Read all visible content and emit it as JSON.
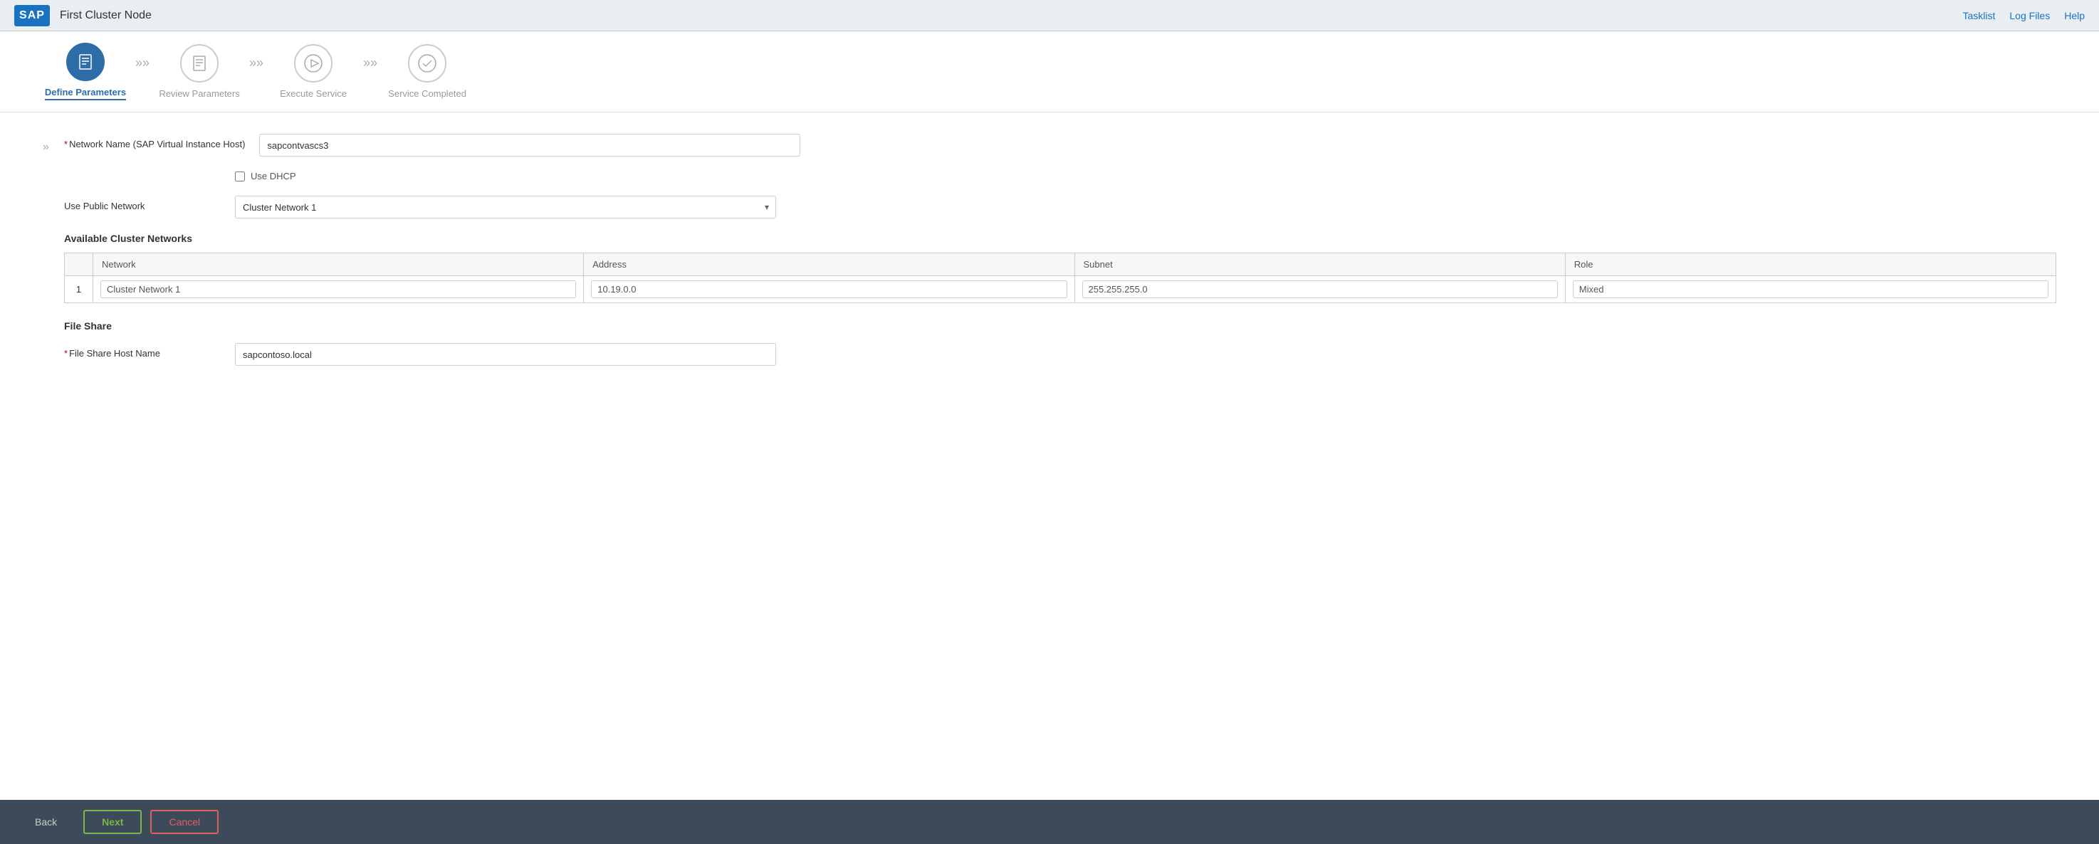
{
  "header": {
    "logo": "SAP",
    "title": "First Cluster Node",
    "nav": [
      "Tasklist",
      "Log Files",
      "Help"
    ]
  },
  "wizard": {
    "steps": [
      {
        "id": "define",
        "label": "Define Parameters",
        "icon": "≡",
        "active": true
      },
      {
        "id": "review",
        "label": "Review Parameters",
        "icon": "≡",
        "active": false
      },
      {
        "id": "execute",
        "label": "Execute Service",
        "icon": "▷",
        "active": false
      },
      {
        "id": "completed",
        "label": "Service Completed",
        "icon": "✓",
        "active": false
      }
    ]
  },
  "form": {
    "network_name_label": "Network Name (SAP Virtual Instance Host)",
    "network_name_required": "*",
    "network_name_value": "sapcontvascs3",
    "use_dhcp_label": "Use DHCP",
    "use_public_network_label": "Use Public Network",
    "public_network_value": "Cluster Network 1",
    "available_cluster_heading": "Available Cluster Networks",
    "table_columns": [
      "Network",
      "Address",
      "Subnet",
      "Role"
    ],
    "table_rows": [
      {
        "num": "1",
        "network": "Cluster Network 1",
        "address": "10.19.0.0",
        "subnet": "255.255.255.0",
        "role": "Mixed"
      }
    ],
    "file_share_heading": "File Share",
    "file_share_host_label": "File Share Host Name",
    "file_share_host_required": "*",
    "file_share_host_value": "sapcontoso.local"
  },
  "footer": {
    "back_label": "Back",
    "next_label": "Next",
    "cancel_label": "Cancel"
  }
}
